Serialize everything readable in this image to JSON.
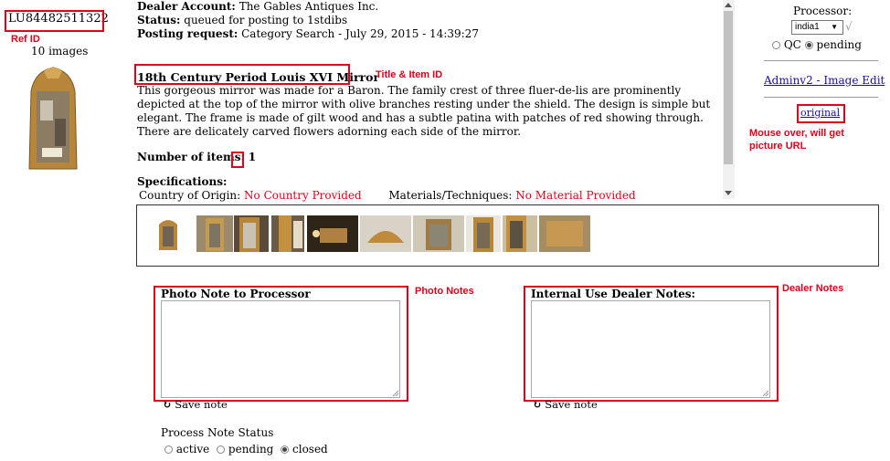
{
  "ref": {
    "id": "LU84482511322",
    "images_count": "10 images"
  },
  "details": {
    "dealer_label": "Dealer Account:",
    "dealer_value": "The Gables Antiques Inc.",
    "status_label": "Status:",
    "status_value": "queued for posting to 1stdibs",
    "posting_label": "Posting request:",
    "posting_value": "Category Search - July 29, 2015 - 14:39:27",
    "title": "18th Century Period Louis XVI Mirror",
    "description": "This gorgeous mirror was made for a Baron. The family crest of three fluer-de-lis are prominently depicted at the top of the mirror with olive branches resting under the shield. The design is simple but elegant. The frame is made of gilt wood and has a subtle patina with patches of red showing through. There are delicately carved flowers adorning each side of the mirror.",
    "items_label": "Number of items:",
    "items_value": "1",
    "specs_label": "Specifications:",
    "country_label": "Country of Origin:",
    "country_value": "No Country Provided",
    "materials_label": "Materials/Techniques:",
    "materials_value": "No Material Provided"
  },
  "processor": {
    "label": "Processor:",
    "selected": "india1",
    "tick": "√",
    "qc_label": "QC",
    "pending_label": "pending",
    "qc_state": "pending"
  },
  "links": {
    "image_edit": "Adminv2 - Image Edit",
    "original": "original"
  },
  "notes": {
    "photo_label": "Photo Note to Processor",
    "photo_value": "",
    "dealer_label": "Internal Use Dealer Notes:",
    "dealer_value": "",
    "save_label": "Save note",
    "save_icon": "↻"
  },
  "process_status": {
    "label": "Process Note Status",
    "options": [
      "active",
      "pending",
      "closed"
    ],
    "selected": "closed"
  },
  "annotations": {
    "ref_id": "Ref ID",
    "title_item": "Title & Item ID",
    "mouse_over": "Mouse over, will get picture URL",
    "photo_notes": "Photo Notes",
    "dealer_notes": "Dealer Notes"
  },
  "colors": {
    "annotation": "#e0001b",
    "link": "#1a0dab",
    "missing_value": "#e0001b"
  }
}
